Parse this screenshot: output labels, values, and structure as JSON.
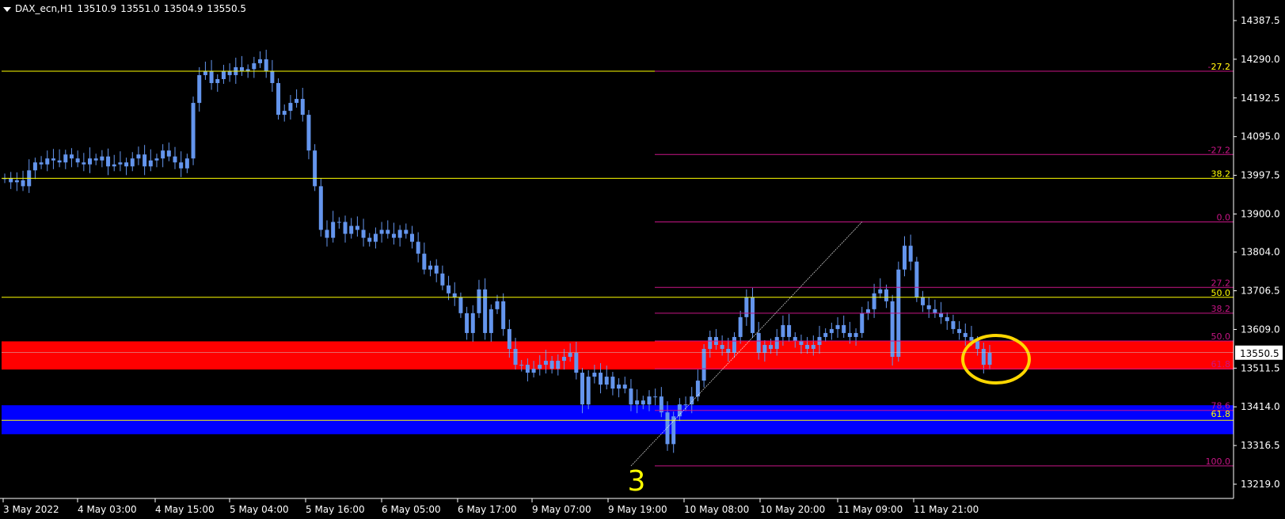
{
  "header": {
    "symbol": "DAX_ecn,H1",
    "open": "13510.9",
    "high": "13551.0",
    "low": "13504.9",
    "close": "13550.5"
  },
  "wave_label": "3",
  "current_price_label": "13550.5",
  "colors": {
    "background": "#000000",
    "axis": "#ffffff",
    "candle": "#6495ed",
    "yellow_level": "#ffff00",
    "fib": "#c71585",
    "red_zone": "#ff0000",
    "blue_zone": "#0000ff",
    "circle": "#ffd700"
  },
  "chart_data": {
    "type": "candlestick",
    "y_ticks": [
      "14387.5",
      "14290.0",
      "14192.5",
      "14095.0",
      "13997.5",
      "13900.0",
      "13804.0",
      "13706.5",
      "13609.0",
      "13511.5",
      "13414.0",
      "13316.5",
      "13219.0"
    ],
    "ylim": [
      13200,
      14420
    ],
    "x_ticks": [
      "3 May 2022",
      "4 May 03:00",
      "4 May 15:00",
      "5 May 04:00",
      "5 May 16:00",
      "6 May 05:00",
      "6 May 17:00",
      "9 May 07:00",
      "9 May 19:00",
      "10 May 08:00",
      "10 May 20:00",
      "11 May 09:00",
      "11 May 21:00"
    ],
    "candles_close": [
      13990,
      13980,
      13985,
      13970,
      14010,
      14030,
      14025,
      14040,
      14035,
      14030,
      14050,
      14040,
      14030,
      14025,
      14040,
      14035,
      14045,
      14020,
      14025,
      14030,
      14020,
      14040,
      14050,
      14020,
      14035,
      14040,
      14060,
      14045,
      14030,
      14015,
      14040,
      14180,
      14250,
      14260,
      14230,
      14240,
      14260,
      14250,
      14270,
      14260,
      14265,
      14280,
      14290,
      14260,
      14230,
      14150,
      14160,
      14180,
      14190,
      14150,
      14060,
      13970,
      13860,
      13840,
      13880,
      13880,
      13850,
      13870,
      13860,
      13840,
      13830,
      13850,
      13860,
      13850,
      13840,
      13860,
      13850,
      13830,
      13800,
      13760,
      13770,
      13750,
      13720,
      13700,
      13690,
      13650,
      13600,
      13650,
      13710,
      13600,
      13660,
      13680,
      13610,
      13560,
      13520,
      13520,
      13500,
      13510,
      13520,
      13530,
      13510,
      13530,
      13540,
      13550,
      13500,
      13420,
      13490,
      13500,
      13470,
      13490,
      13460,
      13470,
      13460,
      13420,
      13430,
      13420,
      13440,
      13440,
      13400,
      13320,
      13390,
      13420,
      13420,
      13440,
      13480,
      13560,
      13590,
      13570,
      13560,
      13550,
      13590,
      13640,
      13690,
      13600,
      13550,
      13570,
      13560,
      13590,
      13620,
      13590,
      13580,
      13570,
      13560,
      13570,
      13590,
      13600,
      13610,
      13620,
      13600,
      13590,
      13600,
      13650,
      13660,
      13700,
      13710,
      13680,
      13540,
      13760,
      13820,
      13780,
      13690,
      13670,
      13660,
      13650,
      13640,
      13630,
      13610,
      13600,
      13590,
      13580,
      13560,
      13520,
      13550
    ],
    "yellow_levels": [
      14260,
      13990,
      13690,
      13380
    ],
    "fib_levels": [
      {
        "label": "-27.2",
        "value": 14260
      },
      {
        "label": "-27.2",
        "value": 14050
      },
      {
        "label": "0.0",
        "value": 13880
      },
      {
        "label": "27.2",
        "value": 13715
      },
      {
        "label": "38.2",
        "value": 13650
      },
      {
        "label": "50.0",
        "value": 13580
      },
      {
        "label": "61.8",
        "value": 13510
      },
      {
        "label": "78.6",
        "value": 13405
      },
      {
        "label": "100.0",
        "value": 13265
      }
    ],
    "yellow_level_labels": [
      {
        "label": "27.2",
        "value": 14260
      },
      {
        "label": "38.2",
        "value": 13990
      },
      {
        "label": "50.0",
        "value": 13690
      },
      {
        "label": "61.8",
        "value": 13385
      }
    ],
    "red_zone": [
      13508,
      13579
    ],
    "blue_zone": [
      13345,
      13418
    ],
    "trendline": [
      {
        "candle": 103,
        "value": 13265
      },
      {
        "candle": 141,
        "value": 13880
      }
    ]
  }
}
